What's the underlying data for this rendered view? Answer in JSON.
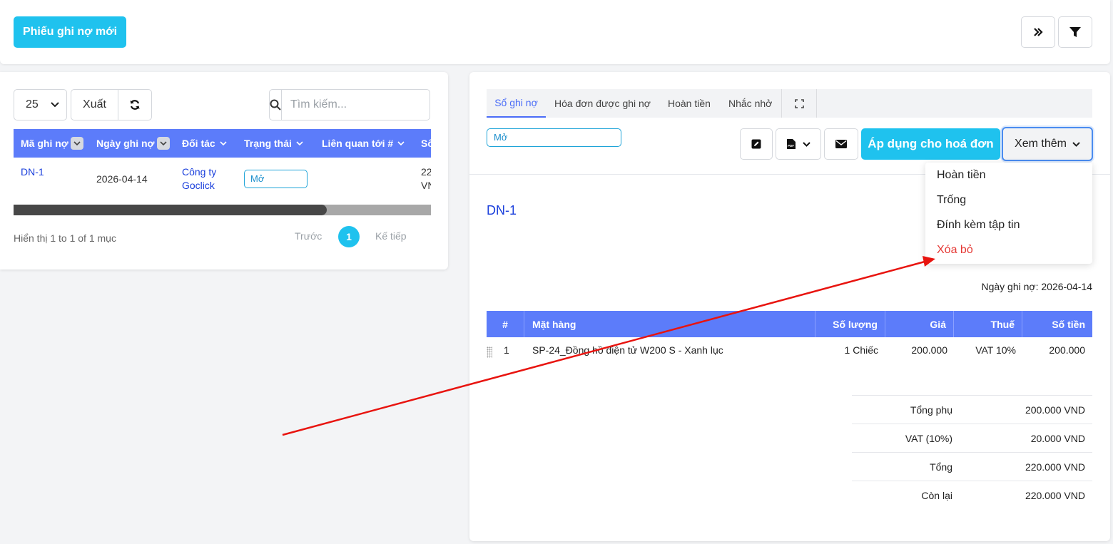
{
  "topbar": {
    "new_button_label": "Phiếu ghi nợ mới",
    "collapse_icon": "double-chevron-right-icon",
    "filter_icon": "filter-icon"
  },
  "list": {
    "page_size": "25",
    "export_label": "Xuất",
    "refresh_icon": "refresh-icon",
    "search_placeholder": "Tìm kiếm...",
    "columns": [
      "Mã ghi nợ",
      "Ngày ghi nợ",
      "Đối tác",
      "Trạng thái",
      "Liên quan tới #",
      "Số"
    ],
    "rows": [
      {
        "code": "DN-1",
        "date": "2026-04-14",
        "partner_line1": "Công ty",
        "partner_line2": "Goclick",
        "status": "Mở",
        "related": "",
        "amount_line1": "22",
        "amount_line2": "VN"
      }
    ],
    "scroll_fraction": 0.75,
    "info": "Hiển thị 1 to 1 of 1 mục",
    "prev_label": "Trước",
    "current_page": "1",
    "next_label": "Kế tiếp"
  },
  "detail": {
    "tabs": [
      "Sổ ghi nợ",
      "Hóa đơn được ghi nợ",
      "Hoàn tiền",
      "Nhắc nhở"
    ],
    "active_tab": "Sổ ghi nợ",
    "fullscreen_icon": "expand-icon",
    "status": "Mở",
    "edit_icon": "edit-icon",
    "pdf_icon": "pdf-icon",
    "email_icon": "envelope-icon",
    "apply_label": "Áp dụng cho hoá đơn",
    "more_label": "Xem thêm",
    "doc_title": "DN-1",
    "date_label": "Ngày ghi nợ:",
    "date_value": "2026-04-14",
    "item_columns": [
      "#",
      "Mặt hàng",
      "Số lượng",
      "Giá",
      "Thuế",
      "Số tiền"
    ],
    "items": [
      {
        "no": "1",
        "name": "SP-24_Đồng hồ điện tử W200 S - Xanh lục",
        "qty": "1 Chiếc",
        "price": "200.000",
        "tax": "VAT 10%",
        "amount": "200.000"
      }
    ],
    "totals": [
      {
        "label": "Tổng phụ",
        "value": "200.000 VND"
      },
      {
        "label": "VAT (10%)",
        "value": "20.000 VND"
      },
      {
        "label": "Tổng",
        "value": "220.000 VND"
      },
      {
        "label": "Còn lại",
        "value": "220.000 VND"
      }
    ]
  },
  "more_menu": {
    "items": [
      "Hoàn tiền",
      "Trống",
      "Đính kèm tập tin",
      "Xóa bỏ"
    ]
  },
  "colors": {
    "accent": "#1fc2ee",
    "table_header": "#5c7cfa",
    "link": "#1a3fdc",
    "danger": "#e53935",
    "annotation_arrow": "#e8140f"
  }
}
